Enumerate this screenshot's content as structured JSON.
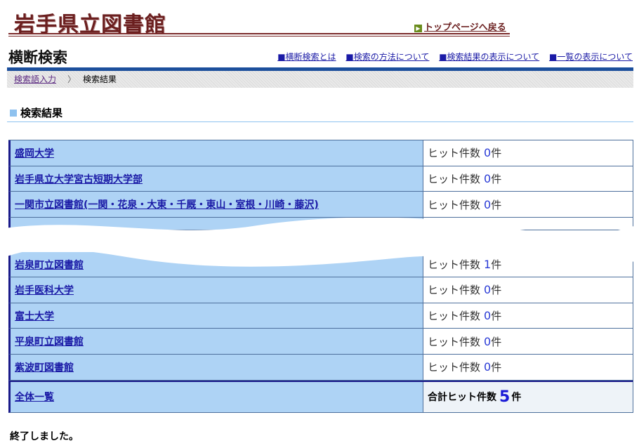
{
  "header": {
    "logo": "岩手県立図書館",
    "top_link": "トップページへ戻る",
    "page_title": "横断検索",
    "help_links": [
      "■横断検索とは",
      "■検索の方法について",
      "■検索結果の表示について",
      "■一覧の表示について"
    ]
  },
  "breadcrumb": {
    "link": "検索語入力",
    "separator": "〉",
    "current": "検索結果"
  },
  "section_title": "検索結果",
  "results_top": [
    {
      "name": "盛岡大学",
      "hit_label": "ヒット件数",
      "count": "0",
      "unit": "件"
    },
    {
      "name": "岩手県立大学宮古短期大学部",
      "hit_label": "ヒット件数",
      "count": "0",
      "unit": "件"
    },
    {
      "name": "一関市立図書館(一関・花泉・大東・千厩・東山・室根・川崎・藤沢)",
      "hit_label": "ヒット件数",
      "count": "0",
      "unit": "件"
    }
  ],
  "results_bottom": [
    {
      "name": "岩泉町立図書館",
      "hit_label": "ヒット件数",
      "count": "1",
      "unit": "件"
    },
    {
      "name": "岩手医科大学",
      "hit_label": "ヒット件数",
      "count": "0",
      "unit": "件"
    },
    {
      "name": "富士大学",
      "hit_label": "ヒット件数",
      "count": "0",
      "unit": "件"
    },
    {
      "name": "平泉町立図書館",
      "hit_label": "ヒット件数",
      "count": "0",
      "unit": "件"
    },
    {
      "name": "紫波町図書館",
      "hit_label": "ヒット件数",
      "count": "0",
      "unit": "件"
    }
  ],
  "total": {
    "name": "全体一覧",
    "label": "合計ヒット件数",
    "count": "5",
    "unit": "件"
  },
  "status_message": "終了しました。",
  "colors": {
    "name_cell_bg": "#aed3f5",
    "link": "#1a1aa6",
    "count": "#2a3bd6",
    "rule_blue": "#1c4f9c",
    "logo": "#6b1f1f"
  }
}
